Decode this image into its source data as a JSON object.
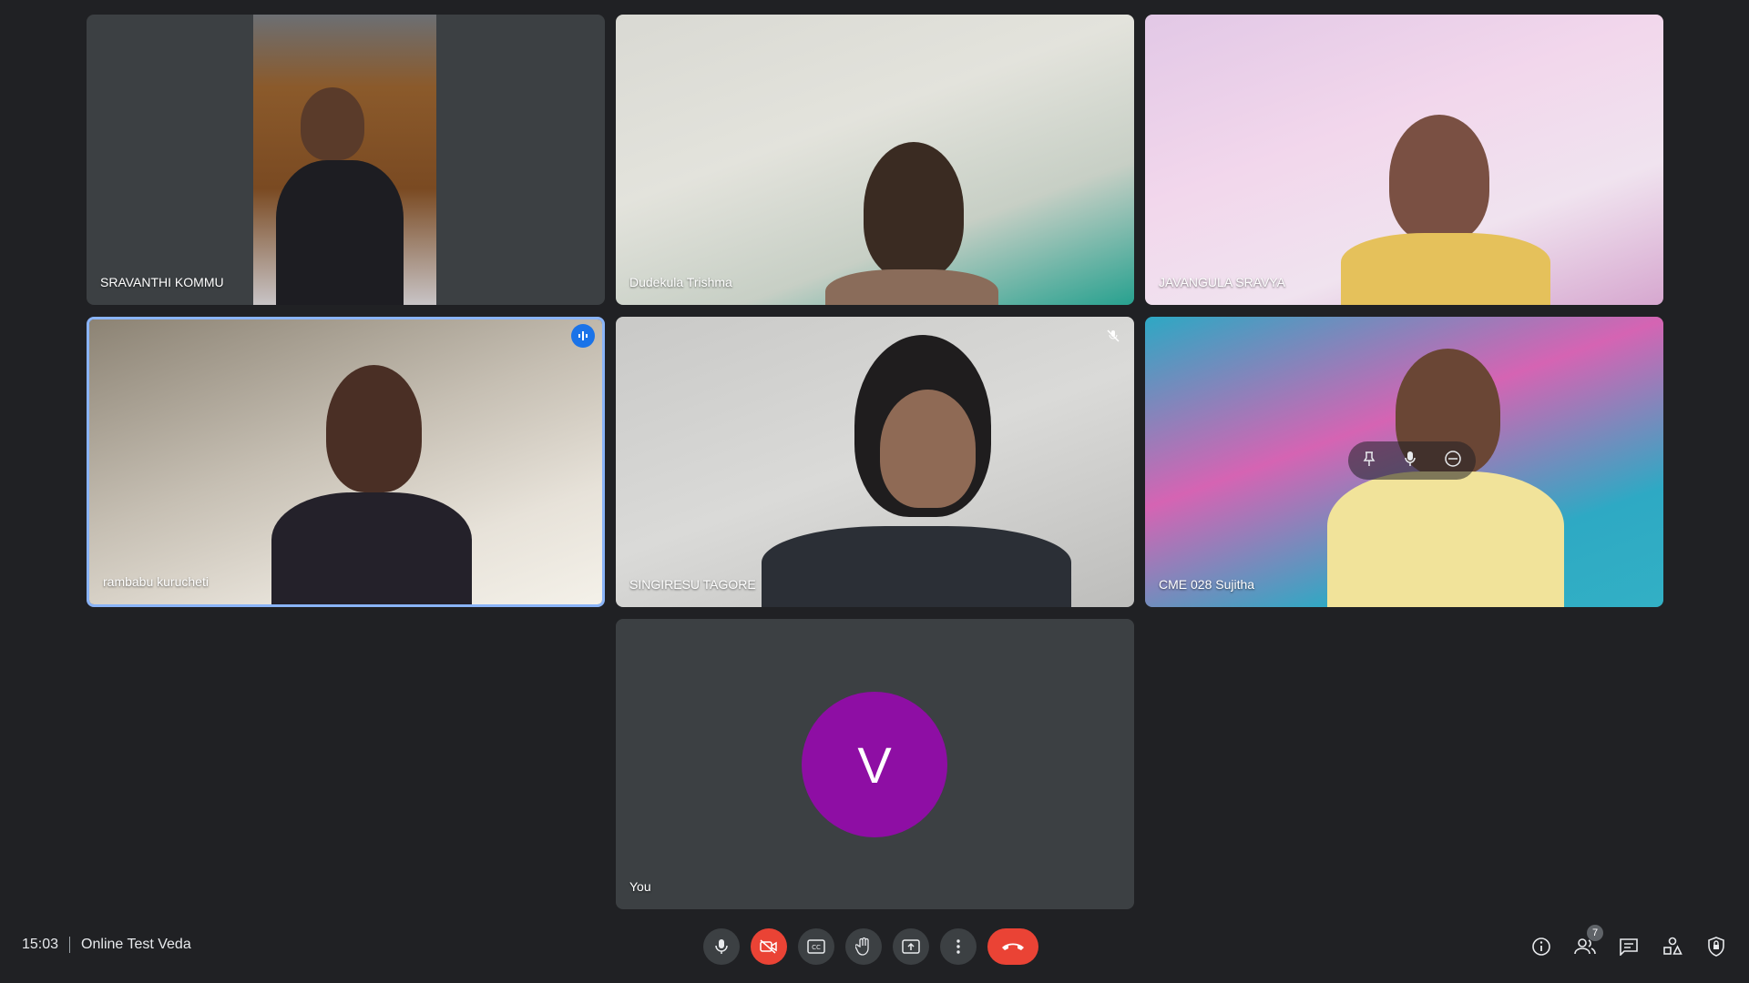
{
  "participants": [
    {
      "name": "SRAVANTHI KOMMU"
    },
    {
      "name": "Dudekula Trishma"
    },
    {
      "name": "JAVANGULA SRAVYA"
    },
    {
      "name": "rambabu kurucheti"
    },
    {
      "name": "SINGIRESU TAGORE"
    },
    {
      "name": "CME 028 Sujitha"
    },
    {
      "name": "You",
      "avatar_letter": "V",
      "avatar_color": "#8e0ea4"
    }
  ],
  "footer": {
    "time": "15:03",
    "meeting_title": "Online Test Veda",
    "people_count": "7"
  },
  "icons": {
    "speaking": "audio-level-icon",
    "muted": "mic-off-icon",
    "pin": "pin-icon",
    "mic": "mic-icon",
    "remove": "remove-icon",
    "captions": "cc-icon",
    "raise_hand": "hand-icon",
    "present": "present-icon",
    "more": "more-vert-icon",
    "hangup": "call-end-icon",
    "info": "info-icon",
    "people": "people-icon",
    "chat": "chat-icon",
    "activities": "activities-icon",
    "host_controls": "shield-icon"
  },
  "colors": {
    "background": "#202124",
    "tile": "#3c4043",
    "speaking_border": "#8ab4f8",
    "danger": "#ea4335",
    "accent": "#1a73e8"
  }
}
